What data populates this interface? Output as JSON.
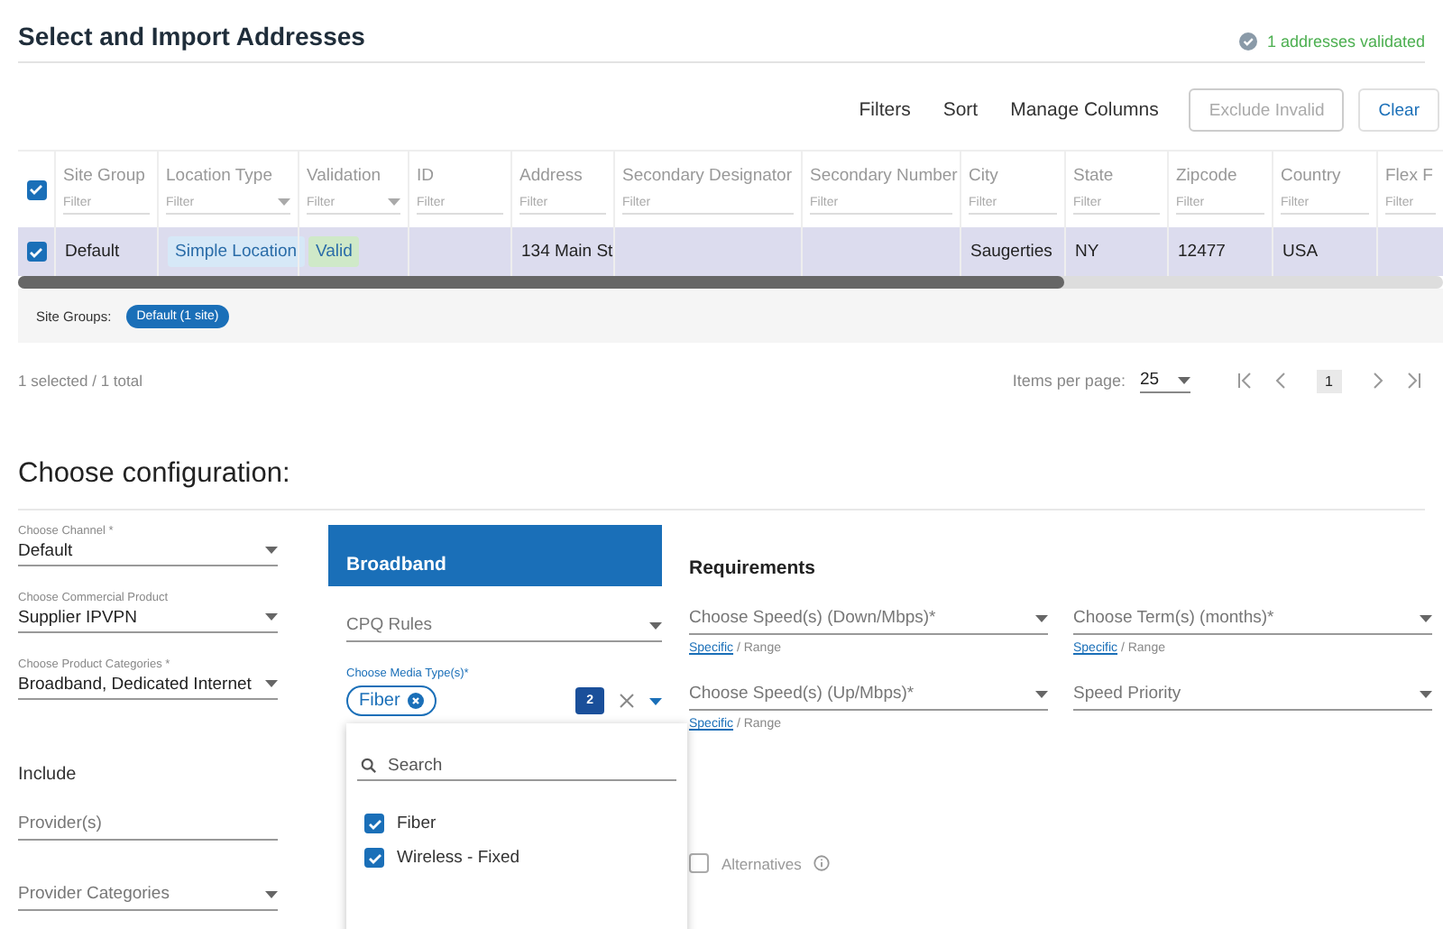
{
  "header": {
    "title": "Select and Import Addresses",
    "status": "1 addresses validated"
  },
  "toolbar": {
    "actions": [
      "Filters",
      "Sort",
      "Manage Columns"
    ],
    "buttons": [
      {
        "label": "Exclude Invalid",
        "disabled": true
      },
      {
        "label": "Clear",
        "disabled": false
      }
    ]
  },
  "table": {
    "all_selected": true,
    "columns": [
      {
        "label": "Site Group",
        "filter": "Filter",
        "dropdown": false
      },
      {
        "label": "Location Type",
        "filter": "Filter",
        "dropdown": true
      },
      {
        "label": "Validation",
        "filter": "Filter",
        "dropdown": true
      },
      {
        "label": "ID",
        "filter": "Filter",
        "dropdown": false
      },
      {
        "label": "Address",
        "filter": "Filter",
        "dropdown": false
      },
      {
        "label": "Secondary Designator",
        "filter": "Filter",
        "dropdown": false
      },
      {
        "label": "Secondary Number",
        "filter": "Filter",
        "dropdown": false
      },
      {
        "label": "City",
        "filter": "Filter",
        "dropdown": false
      },
      {
        "label": "State",
        "filter": "Filter",
        "dropdown": false
      },
      {
        "label": "Zipcode",
        "filter": "Filter",
        "dropdown": false
      },
      {
        "label": "Country",
        "filter": "Filter",
        "dropdown": false
      },
      {
        "label": "Flex F",
        "filter": "Filter",
        "dropdown": false
      }
    ],
    "rows": [
      {
        "selected": true,
        "cells": [
          {
            "kind": "plain",
            "text": "Default"
          },
          {
            "kind": "tag",
            "text": "Simple Location",
            "color": "#d6e8f7"
          },
          {
            "kind": "tag",
            "text": "Valid",
            "color": "#cfe9c8"
          },
          {
            "kind": "empty"
          },
          {
            "kind": "plain",
            "text": "134 Main St"
          },
          {
            "kind": "empty"
          },
          {
            "kind": "empty"
          },
          {
            "kind": "plain",
            "text": "Saugerties"
          },
          {
            "kind": "plain",
            "text": "NY"
          },
          {
            "kind": "plain",
            "text": "12477"
          },
          {
            "kind": "plain",
            "text": "USA"
          },
          {
            "kind": "empty"
          }
        ]
      }
    ]
  },
  "site_groups": {
    "label": "Site Groups:",
    "chips": [
      "Default (1 site)"
    ]
  },
  "footer": {
    "summary": "1 selected / 1 total",
    "items_per_page_label": "Items per page:",
    "items_per_page": "25",
    "page": "1"
  },
  "config": {
    "title": "Choose configuration:",
    "fields": [
      {
        "label": "Choose Channel *",
        "value": "Default"
      },
      {
        "label": "Choose Commercial Product",
        "value": "Supplier IPVPN"
      },
      {
        "label": "Choose Product Categories *",
        "value": "Broadband, Dedicated Internet"
      }
    ],
    "include": {
      "title": "Include",
      "provider_placeholder": "Provider(s)",
      "categories_placeholder": "Provider Categories"
    },
    "broadband": {
      "title": "Broadband",
      "cpq_placeholder": "CPQ Rules",
      "media_label": "Choose Media Type(s)*",
      "chips": [
        "Fiber"
      ],
      "count": "2",
      "dropdown": {
        "search_placeholder": "Search",
        "options": [
          {
            "label": "Fiber",
            "checked": true
          },
          {
            "label": "Wireless - Fixed",
            "checked": true
          }
        ]
      }
    },
    "requirements": {
      "title": "Requirements",
      "fields": [
        {
          "placeholder": "Choose Speed(s) (Down/Mbps)*",
          "link": "Specific",
          "rest": "/ Range"
        },
        {
          "placeholder": "Choose Term(s) (months)*",
          "link": "Specific",
          "rest": "/ Range"
        },
        {
          "placeholder": "Choose Speed(s) (Up/Mbps)*",
          "link": "Specific",
          "rest": "/ Range"
        },
        {
          "placeholder": "Speed Priority"
        }
      ],
      "alternatives": {
        "label": "Alternatives",
        "checked": false
      }
    }
  }
}
